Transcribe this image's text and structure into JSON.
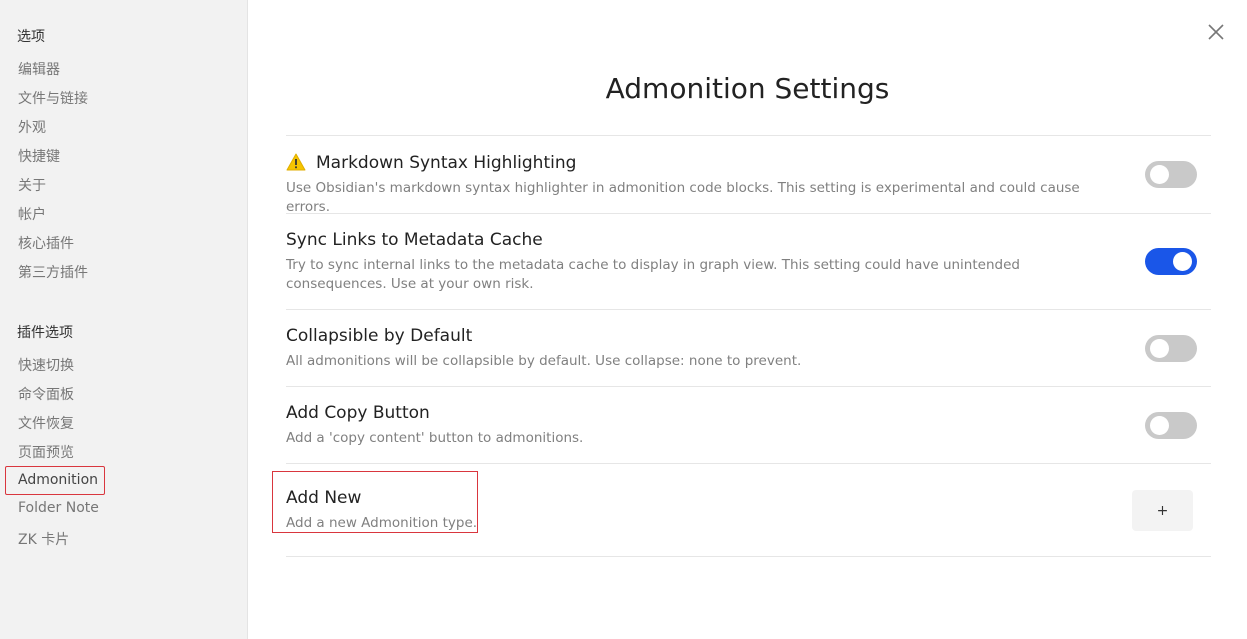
{
  "sidebar": {
    "options_heading": "选项",
    "options_items": [
      "编辑器",
      "文件与链接",
      "外观",
      "快捷键",
      "关于",
      "帐户",
      "核心插件",
      "第三方插件"
    ],
    "plugin_heading": "插件选项",
    "plugin_items": [
      "快速切换",
      "命令面板",
      "文件恢复",
      "页面预览",
      "Admonition",
      "Folder Note",
      "ZK 卡片"
    ],
    "active_item": "Admonition"
  },
  "title": "Admonition Settings",
  "settings": [
    {
      "name": "Markdown Syntax Highlighting",
      "desc": "Use Obsidian's markdown syntax highlighter in admonition code blocks. This setting is experimental and could cause errors.",
      "enabled": false,
      "icon": "warning-icon"
    },
    {
      "name": "Sync Links to Metadata Cache",
      "desc": "Try to sync internal links to the metadata cache to display in graph view. This setting could have unintended consequences. Use at your own risk.",
      "enabled": true
    },
    {
      "name": "Collapsible by Default",
      "desc": "All admonitions will be collapsible by default. Use collapse: none to prevent.",
      "enabled": false
    },
    {
      "name": "Add Copy Button",
      "desc": "Add a 'copy content' button to admonitions.",
      "enabled": false
    }
  ],
  "add_new": {
    "name": "Add New",
    "desc": "Add a new Admonition type.",
    "button_label": "+"
  },
  "colors": {
    "accent": "#1a56e8",
    "highlight": "#d9363e",
    "warning": "#f5c400"
  }
}
